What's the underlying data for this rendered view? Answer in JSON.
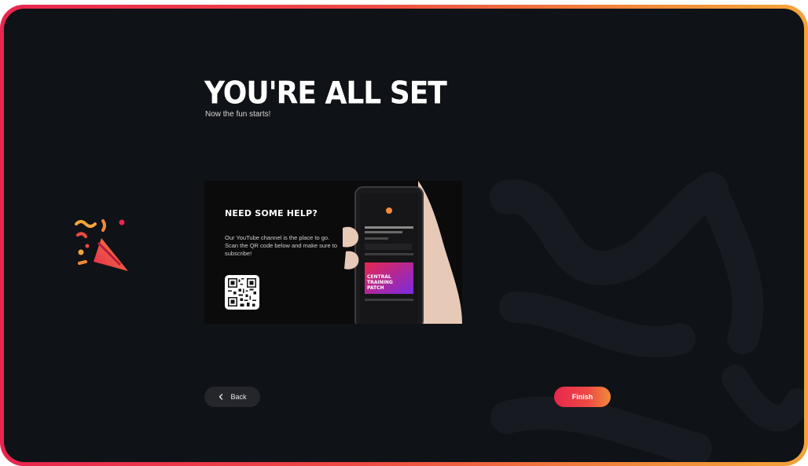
{
  "page": {
    "title": "YOU'RE ALL SET",
    "subtitle": "Now the fun starts!"
  },
  "help_card": {
    "heading": "NEED SOME HELP?",
    "body": "Our YouTube channel is the place to go. Scan the QR code below and make sure to subscribe!",
    "qr_icon": "qr-code-icon",
    "phone_banner_text": "CENTRAL TRAINING PATCH"
  },
  "nav": {
    "back_label": "Back",
    "back_icon": "chevron-left-icon",
    "finish_label": "Finish"
  },
  "colors": {
    "accent_start": "#e8264f",
    "accent_end": "#f08a3a",
    "background": "#0f1216"
  },
  "decoration": {
    "celebration_icon": "party-popper-icon"
  }
}
